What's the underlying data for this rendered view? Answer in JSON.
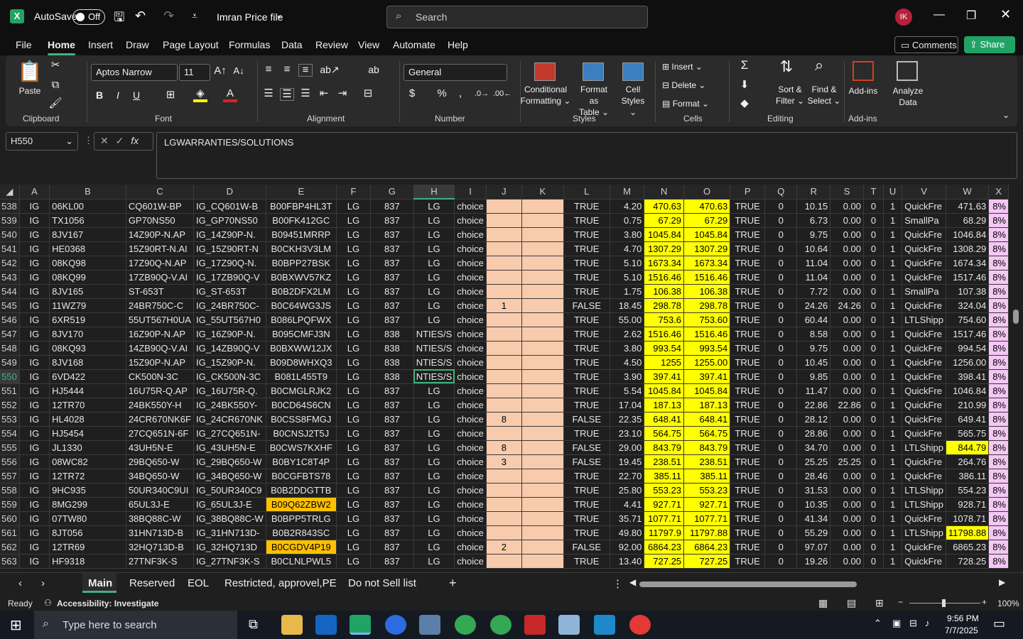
{
  "titlebar": {
    "autosave_label": "AutoSave",
    "autosave_state": "Off",
    "file_name": "Imran Price file",
    "search_placeholder": "Search",
    "avatar_initials": "IK"
  },
  "menu": [
    "File",
    "Home",
    "Insert",
    "Draw",
    "Page Layout",
    "Formulas",
    "Data",
    "Review",
    "View",
    "Automate",
    "Help"
  ],
  "menu_active": "Home",
  "comments_label": "Comments",
  "share_label": "Share",
  "ribbon": {
    "paste": "Paste",
    "clipboard": "Clipboard",
    "font_name": "Aptos Narrow",
    "font_size": "11",
    "font_group": "Font",
    "alignment_group": "Alignment",
    "number_format": "General",
    "number_group": "Number",
    "conditional_1": "Conditional",
    "conditional_2": "Formatting",
    "format_table_1": "Format as",
    "format_table_2": "Table",
    "cell_styles_1": "Cell",
    "cell_styles_2": "Styles",
    "styles_group": "Styles",
    "insert": "Insert",
    "delete": "Delete",
    "format": "Format",
    "cells_group": "Cells",
    "sort_1": "Sort &",
    "sort_2": "Filter",
    "find_1": "Find &",
    "find_2": "Select",
    "editing_group": "Editing",
    "addins": "Add-ins",
    "addins_group": "Add-ins",
    "analyze_1": "Analyze",
    "analyze_2": "Data"
  },
  "formula_bar": {
    "name_box": "H550",
    "content": "LGWARRANTIES/SOLUTIONS"
  },
  "columns": [
    "A",
    "B",
    "C",
    "D",
    "E",
    "F",
    "G",
    "H",
    "I",
    "J",
    "K",
    "L",
    "M",
    "N",
    "O",
    "P",
    "Q",
    "R",
    "S",
    "T",
    "U",
    "V",
    "W",
    "X"
  ],
  "rows": [
    [
      "538",
      "IG",
      "06KL00",
      "CQ601W-BP",
      "IG_CQ601W-B",
      "B00FBP4HL3T",
      "LG",
      "837",
      "LG",
      "choice",
      "",
      "",
      "TRUE",
      "4.20",
      "470.63",
      "470.63",
      "TRUE",
      "0",
      "10.15",
      "0.00",
      "0",
      "1",
      "QuickFre",
      "471.63",
      "8%"
    ],
    [
      "539",
      "IG",
      "TX1056",
      "GP70NS50",
      "IG_GP70NS50",
      "B00FK412GC",
      "LG",
      "837",
      "LG",
      "choice",
      "",
      "",
      "TRUE",
      "0.75",
      "67.29",
      "67.29",
      "TRUE",
      "0",
      "6.73",
      "0.00",
      "0",
      "1",
      "SmallPa",
      "68.29",
      "8%"
    ],
    [
      "540",
      "IG",
      "8JV167",
      "14Z90P-N.AP",
      "IG_14Z90P-N.",
      "B09451MRRP",
      "LG",
      "837",
      "LG",
      "choice",
      "",
      "",
      "TRUE",
      "3.80",
      "1045.84",
      "1045.84",
      "TRUE",
      "0",
      "9.75",
      "0.00",
      "0",
      "1",
      "QuickFre",
      "1046.84",
      "8%"
    ],
    [
      "541",
      "IG",
      "HE0368",
      "15Z90RT-N.AI",
      "IG_15Z90RT-N",
      "B0CKH3V3LM",
      "LG",
      "837",
      "LG",
      "choice",
      "",
      "",
      "TRUE",
      "4.70",
      "1307.29",
      "1307.29",
      "TRUE",
      "0",
      "10.64",
      "0.00",
      "0",
      "1",
      "QuickFre",
      "1308.29",
      "8%"
    ],
    [
      "542",
      "IG",
      "08KQ98",
      "17Z90Q-N.AP",
      "IG_17Z90Q-N.",
      "B0BPP27BSK",
      "LG",
      "837",
      "LG",
      "choice",
      "",
      "",
      "TRUE",
      "5.10",
      "1673.34",
      "1673.34",
      "TRUE",
      "0",
      "11.04",
      "0.00",
      "0",
      "1",
      "QuickFre",
      "1674.34",
      "8%"
    ],
    [
      "543",
      "IG",
      "08KQ99",
      "17ZB90Q-V.AI",
      "IG_17ZB90Q-V",
      "B0BXWV57KZ",
      "LG",
      "837",
      "LG",
      "choice",
      "",
      "",
      "TRUE",
      "5.10",
      "1516.46",
      "1516.46",
      "TRUE",
      "0",
      "11.04",
      "0.00",
      "0",
      "1",
      "QuickFre",
      "1517.46",
      "8%"
    ],
    [
      "544",
      "IG",
      "8JV165",
      "ST-653T",
      "IG_ST-653T",
      "B0B2DFX2LM",
      "LG",
      "837",
      "LG",
      "choice",
      "",
      "",
      "TRUE",
      "1.75",
      "106.38",
      "106.38",
      "TRUE",
      "0",
      "7.72",
      "0.00",
      "0",
      "1",
      "SmallPa",
      "107.38",
      "8%"
    ],
    [
      "545",
      "IG",
      "11WZ79",
      "24BR750C-C",
      "IG_24BR750C-",
      "B0C64WG3JS",
      "LG",
      "837",
      "LG",
      "choice",
      "1",
      "",
      "FALSE",
      "18.45",
      "298.78",
      "298.78",
      "TRUE",
      "0",
      "24.26",
      "24.26",
      "0",
      "1",
      "QuickFre",
      "324.04",
      "8%"
    ],
    [
      "546",
      "IG",
      "6XR519",
      "55UT567H0UA",
      "IG_55UT567H0",
      "B086LPQFWX",
      "LG",
      "837",
      "LG",
      "choice",
      "",
      "",
      "TRUE",
      "55.00",
      "753.6",
      "753.60",
      "TRUE",
      "0",
      "60.44",
      "0.00",
      "0",
      "1",
      "LTLShipp",
      "754.60",
      "8%"
    ],
    [
      "547",
      "IG",
      "8JV170",
      "16Z90P-N.AP",
      "IG_16Z90P-N.",
      "B095CMFJ3N",
      "LG",
      "838",
      "NTIES/S",
      "choice",
      "",
      "",
      "TRUE",
      "2.62",
      "1516.46",
      "1516.46",
      "TRUE",
      "0",
      "8.58",
      "0.00",
      "0",
      "1",
      "QuickFre",
      "1517.46",
      "8%"
    ],
    [
      "548",
      "IG",
      "08KQ93",
      "14ZB90Q-V.AI",
      "IG_14ZB90Q-V",
      "B0BXWW12JX",
      "LG",
      "838",
      "NTIES/S",
      "choice",
      "",
      "",
      "TRUE",
      "3.80",
      "993.54",
      "993.54",
      "TRUE",
      "0",
      "9.75",
      "0.00",
      "0",
      "1",
      "QuickFre",
      "994.54",
      "8%"
    ],
    [
      "549",
      "IG",
      "8JV168",
      "15Z90P-N.AP",
      "IG_15Z90P-N.",
      "B09D8WHXQ3",
      "LG",
      "838",
      "NTIES/S",
      "choice",
      "",
      "",
      "TRUE",
      "4.50",
      "1255",
      "1255.00",
      "TRUE",
      "0",
      "10.45",
      "0.00",
      "0",
      "1",
      "QuickFre",
      "1256.00",
      "8%"
    ],
    [
      "550",
      "IG",
      "6VD422",
      "CK500N-3C",
      "IG_CK500N-3C",
      "B081L455T9",
      "LG",
      "838",
      "NTIES/S",
      "choice",
      "",
      "",
      "TRUE",
      "3.90",
      "397.41",
      "397.41",
      "TRUE",
      "0",
      "9.85",
      "0.00",
      "0",
      "1",
      "QuickFre",
      "398.41",
      "8%"
    ],
    [
      "551",
      "IG",
      "HJ5444",
      "16U75R-Q.AP",
      "IG_16U75R-Q.",
      "B0CMGLRJK2",
      "LG",
      "837",
      "LG",
      "choice",
      "",
      "",
      "TRUE",
      "5.54",
      "1045.84",
      "1045.84",
      "TRUE",
      "0",
      "11.47",
      "0.00",
      "0",
      "1",
      "QuickFre",
      "1046.84",
      "8%"
    ],
    [
      "552",
      "IG",
      "12TR70",
      "24BK550Y-H",
      "IG_24BK550Y-",
      "B0CD64S6CN",
      "LG",
      "837",
      "LG",
      "choice",
      "",
      "",
      "TRUE",
      "17.04",
      "187.13",
      "187.13",
      "TRUE",
      "0",
      "22.86",
      "22.86",
      "0",
      "1",
      "QuickFre",
      "210.99",
      "8%"
    ],
    [
      "553",
      "IG",
      "HL4028",
      "24CR670NK6F",
      "IG_24CR670NK",
      "B0CSS8FMGJ",
      "LG",
      "837",
      "LG",
      "choice",
      "8",
      "",
      "FALSE",
      "22.35",
      "648.41",
      "648.41",
      "TRUE",
      "0",
      "28.12",
      "0.00",
      "0",
      "1",
      "QuickFre",
      "649.41",
      "8%"
    ],
    [
      "554",
      "IG",
      "HJ5454",
      "27CQ651N-6F",
      "IG_27CQ651N-",
      "B0CNSJ2T5J",
      "LG",
      "837",
      "LG",
      "choice",
      "",
      "",
      "TRUE",
      "23.10",
      "564.75",
      "564.75",
      "TRUE",
      "0",
      "28.86",
      "0.00",
      "0",
      "1",
      "QuickFre",
      "565.75",
      "8%"
    ],
    [
      "555",
      "IG",
      "JL1330",
      "43UH5N-E",
      "IG_43UH5N-E",
      "B0CWS7KXHF",
      "LG",
      "837",
      "LG",
      "choice",
      "8",
      "",
      "FALSE",
      "29.00",
      "843.79",
      "843.79",
      "TRUE",
      "0",
      "34.70",
      "0.00",
      "0",
      "1",
      "LTLShipp",
      "844.79",
      "8%"
    ],
    [
      "556",
      "IG",
      "08WC82",
      "29BQ650-W",
      "IG_29BQ650-W",
      "B0BY1C8T4P",
      "LG",
      "837",
      "LG",
      "choice",
      "3",
      "",
      "FALSE",
      "19.45",
      "238.51",
      "238.51",
      "TRUE",
      "0",
      "25.25",
      "25.25",
      "0",
      "1",
      "QuickFre",
      "264.76",
      "8%"
    ],
    [
      "557",
      "IG",
      "12TR72",
      "34BQ650-W",
      "IG_34BQ650-W",
      "B0CGFBTS78",
      "LG",
      "837",
      "LG",
      "choice",
      "",
      "",
      "TRUE",
      "22.70",
      "385.11",
      "385.11",
      "TRUE",
      "0",
      "28.46",
      "0.00",
      "0",
      "1",
      "QuickFre",
      "386.11",
      "8%"
    ],
    [
      "558",
      "IG",
      "9HC935",
      "50UR340C9UI",
      "IG_50UR340C9",
      "B0B2DDGTTB",
      "LG",
      "837",
      "LG",
      "choice",
      "",
      "",
      "TRUE",
      "25.80",
      "553.23",
      "553.23",
      "TRUE",
      "0",
      "31.53",
      "0.00",
      "0",
      "1",
      "LTLShipp",
      "554.23",
      "8%"
    ],
    [
      "559",
      "IG",
      "8MG299",
      "65UL3J-E",
      "IG_65UL3J-E",
      "B09Q62ZBW2",
      "LG",
      "837",
      "LG",
      "choice",
      "",
      "",
      "TRUE",
      "4.41",
      "927.71",
      "927.71",
      "TRUE",
      "0",
      "10.35",
      "0.00",
      "0",
      "1",
      "LTLShipp",
      "928.71",
      "8%"
    ],
    [
      "560",
      "IG",
      "07TW80",
      "38BQ88C-W",
      "IG_38BQ88C-W",
      "B0BPP5TRLG",
      "LG",
      "837",
      "LG",
      "choice",
      "",
      "",
      "TRUE",
      "35.71",
      "1077.71",
      "1077.71",
      "TRUE",
      "0",
      "41.34",
      "0.00",
      "0",
      "1",
      "QuickFre",
      "1078.71",
      "8%"
    ],
    [
      "561",
      "IG",
      "8JT056",
      "31HN713D-B",
      "IG_31HN713D-",
      "B0B2R843SC",
      "LG",
      "837",
      "LG",
      "choice",
      "",
      "",
      "TRUE",
      "49.80",
      "11797.9",
      "11797.88",
      "TRUE",
      "0",
      "55.29",
      "0.00",
      "0",
      "1",
      "LTLShipp",
      "11798.88",
      "8%"
    ],
    [
      "562",
      "IG",
      "12TR69",
      "32HQ713D-B",
      "IG_32HQ713D",
      "B0CGDV4P19",
      "LG",
      "837",
      "LG",
      "choice",
      "2",
      "",
      "FALSE",
      "92.00",
      "6864.23",
      "6864.23",
      "TRUE",
      "0",
      "97.07",
      "0.00",
      "0",
      "1",
      "QuickFre",
      "6865.23",
      "8%"
    ],
    [
      "563",
      "IG",
      "HF9318",
      "27TNF3K-S",
      "IG_27TNF3K-S",
      "B0CLNLPWL5",
      "LG",
      "837",
      "LG",
      "choice",
      "",
      "",
      "TRUE",
      "13.40",
      "727.25",
      "727.25",
      "TRUE",
      "0",
      "19.26",
      "0.00",
      "0",
      "1",
      "QuickFre",
      "728.25",
      "8%"
    ]
  ],
  "sheet_tabs": [
    "Main",
    "Reserved",
    "EOL",
    "Restricted, approvel,PE",
    "Do not Sell list"
  ],
  "active_sheet": "Main",
  "status": {
    "ready": "Ready",
    "accessibility": "Accessibility: Investigate",
    "zoom": "100%"
  },
  "taskbar": {
    "search_placeholder": "Type here to search",
    "time": "9:56 PM",
    "date": "7/7/2025"
  },
  "colors": {
    "salmon": "#f8cbad",
    "yellow": "#ffff00",
    "pink": "#f4c7f4",
    "orange": "#ffc000",
    "excel_green": "#21a366"
  }
}
